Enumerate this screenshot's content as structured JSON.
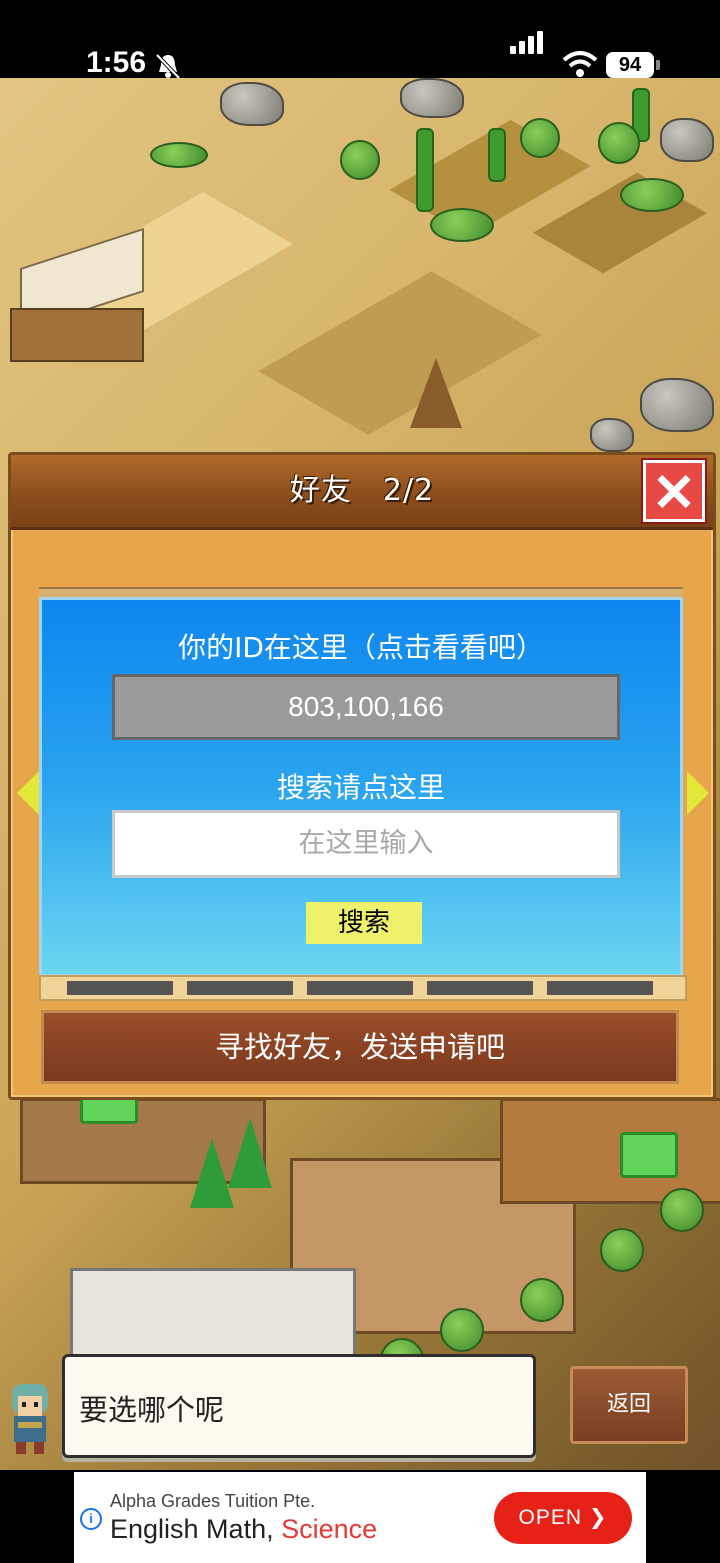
{
  "status_bar": {
    "time": "1:56",
    "battery": "94"
  },
  "dialog": {
    "title": "好友　2/2",
    "id_label": "你的ID在这里（点击看看吧）",
    "player_id": "803,100,166",
    "search_label": "搜索请点这里",
    "search_placeholder": "在这里输入",
    "search_button": "搜索",
    "find_friends": "寻找好友，发送申请吧"
  },
  "bottom": {
    "speech": "要选哪个呢",
    "back_button": "返回"
  },
  "ad": {
    "sponsor": "Alpha Grades Tuition Pte.",
    "headline_part1": "English Math, ",
    "headline_part2": "Science",
    "open_button": "OPEN ❯"
  },
  "colors": {
    "dialog_body": "#e7a64b",
    "header": "#8a4c1c",
    "panel_blue": "#2aa4ee",
    "search_button": "#eef26a",
    "close_button": "#e74a45"
  },
  "icons": [
    "bell-muted-icon",
    "signal-icon",
    "wifi-icon",
    "battery-icon",
    "close-icon",
    "arrow-left-icon",
    "arrow-right-icon",
    "info-icon"
  ]
}
